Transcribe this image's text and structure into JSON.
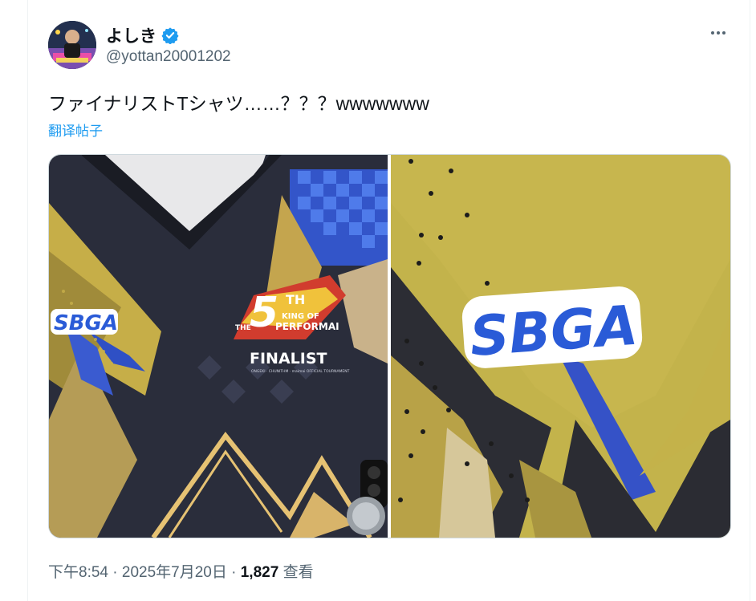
{
  "author": {
    "display_name": "よしき",
    "handle": "@yottan20001202",
    "verified": true,
    "avatar_icon": "profile-photo"
  },
  "tweet": {
    "text": "ファイナリストTシャツ……？？？wwwwwww",
    "translate_label": "翻译帖子"
  },
  "media": {
    "left_photo": {
      "logo_text": "SBGA",
      "badge_line1": "KING OF",
      "badge_line2": "PERFORMAI",
      "badge_th": "TH",
      "badge_the": "THE",
      "finalist_text": "FINALIST",
      "badge_sub": "ONGEKI · CHUNITHM · maimai OFFICIAL TOURNAMENT"
    },
    "right_photo": {
      "logo_text": "SBGA"
    }
  },
  "meta": {
    "time": "下午8:54",
    "separator": "·",
    "date": "2025年7月20日",
    "views_count": "1,827",
    "views_label": "查看"
  },
  "colors": {
    "accent": "#1d9bf0",
    "text_primary": "#0f1419",
    "text_secondary": "#536471",
    "shirt_navy": "#262a3a",
    "shirt_gold": "#c9b24a",
    "sbga_blue": "#2a5bd7"
  }
}
